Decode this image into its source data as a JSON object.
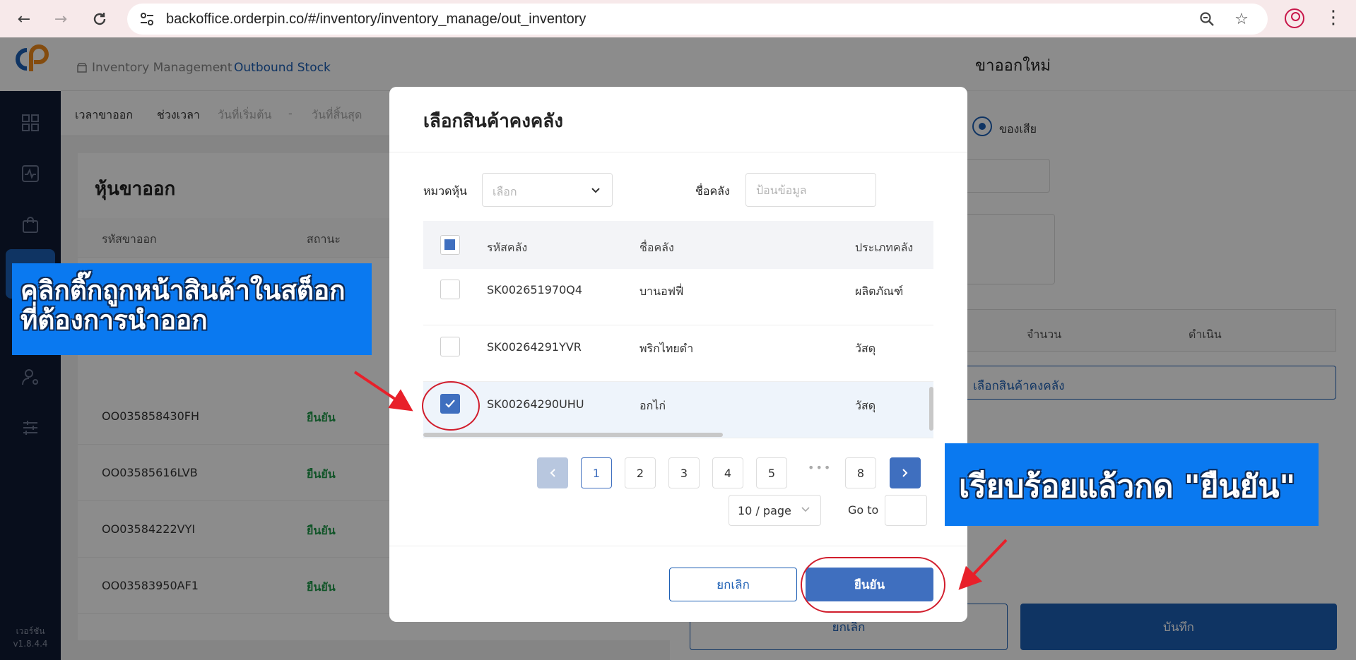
{
  "browser": {
    "url": "backoffice.orderpin.co/#/inventory/inventory_manage/out_inventory"
  },
  "app": {
    "breadcrumb": [
      "Inventory Management",
      "Outbound Stock"
    ],
    "version": [
      "เวอร์ชัน",
      "v1.8.4.4"
    ],
    "filters": {
      "time_label": "เวลาขาออก",
      "range_label": "ช่วงเวลา",
      "start_placeholder": "วันที่เริ่มต้น",
      "separator": "-",
      "end_placeholder": "วันที่สิ้นสุด"
    },
    "list": {
      "title": "หุ้นขาออก",
      "headers": [
        "รหัสขาออก",
        "สถานะ"
      ],
      "rows": [
        {
          "code": "OO035858430FH",
          "status": "ยืนยัน"
        },
        {
          "code": "OO03585616LVB",
          "status": "ยืนยัน"
        },
        {
          "code": "OO03584222VYI",
          "status": "ยืนยัน"
        },
        {
          "code": "OO03583950AF1",
          "status": "ยืนยัน"
        }
      ]
    },
    "drawer": {
      "title": "ขาออกใหม่",
      "radio_label": "ของเสีย",
      "headers": [
        "จำนวน",
        "ดำเนิน"
      ],
      "pick_button": "เลือกสินค้าคงคลัง",
      "cancel": "ยกเลิก",
      "save": "บันทึก"
    }
  },
  "modal": {
    "title": "เลือกสินค้าคงคลัง",
    "category_label": "หมวดหุ้น",
    "category_placeholder": "เลือก",
    "name_label": "ชื่อคลัง",
    "name_placeholder": "ป้อนข้อมูล",
    "columns": [
      "รหัสคลัง",
      "ชื่อคลัง",
      "ประเภทคลัง"
    ],
    "rows": [
      {
        "code": "SK002651970Q4",
        "name": "บานอฟฟี่",
        "type": "ผลิตภัณฑ์",
        "checked": false
      },
      {
        "code": "SK00264291YVR",
        "name": "พริกไทยดำ",
        "type": "วัสดุ",
        "checked": false
      },
      {
        "code": "SK00264290UHU",
        "name": "อกไก่",
        "type": "วัสดุ",
        "checked": true
      }
    ],
    "pagination": {
      "pages": [
        "1",
        "2",
        "3",
        "4",
        "5",
        "8"
      ],
      "current": "1",
      "ellipsis": "•••",
      "page_size": "10 / page",
      "goto_label": "Go to"
    },
    "cancel": "ยกเลิก",
    "confirm": "ยืนยัน"
  },
  "annotations": {
    "left": [
      "คลิกติ๊กถูกหน้าสินค้าในสต็อก",
      "ที่ต้องการนำออก"
    ],
    "right": "เรียบร้อยแล้วกด \"ยืนยัน\"",
    "color": "#0a79f0",
    "highlight_color": "#d11d2c"
  },
  "colors": {
    "primary": "#3f6fbf",
    "sidebar": "#0f1a33",
    "success": "#1f9a4a"
  }
}
